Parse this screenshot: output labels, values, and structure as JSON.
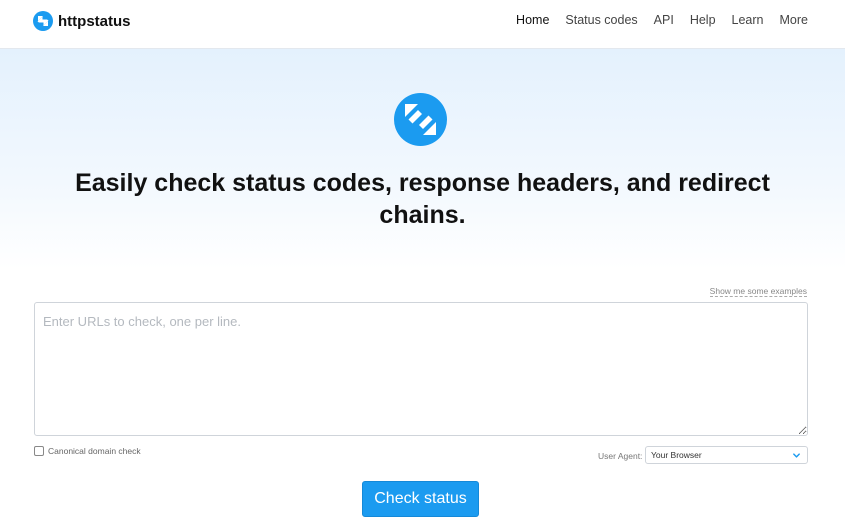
{
  "brand": {
    "name": "httpstatus",
    "logo_icon": "arrows-exchange-icon",
    "accent_color": "#1b9bf0"
  },
  "nav": {
    "items": [
      {
        "label": "Home",
        "active": true
      },
      {
        "label": "Status codes"
      },
      {
        "label": "API"
      },
      {
        "label": "Help"
      },
      {
        "label": "Learn"
      },
      {
        "label": "More"
      }
    ]
  },
  "hero": {
    "logo_icon": "arrows-exchange-icon",
    "headline": {
      "part1": "Easily check ",
      "bold1": "status codes",
      "part2": ", ",
      "bold2": "response headers",
      "part3": ", and ",
      "bold3": "redirect chains",
      "part4": "."
    }
  },
  "form": {
    "examples_link": "Show me some examples",
    "url_placeholder": "Enter URLs to check, one per line.",
    "url_value": "",
    "canonical_label": "Canonical domain check",
    "canonical_checked": false,
    "user_agent_label": "User Agent:",
    "user_agent_value": "Your Browser",
    "submit_label": "Check status"
  }
}
